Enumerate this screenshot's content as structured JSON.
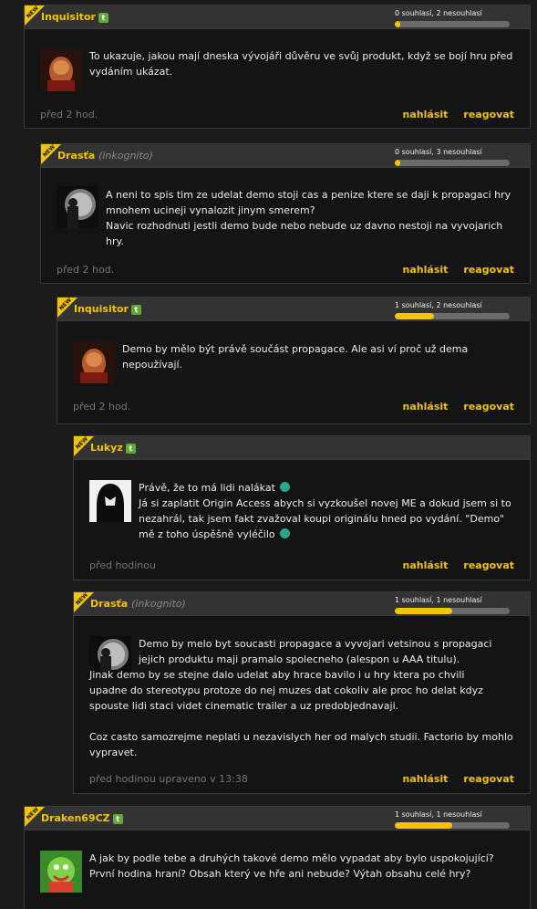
{
  "comments": [
    {
      "author": "Inquisitor",
      "incognito": "",
      "badge": "t",
      "votes_text": "0 souhlasí, 2 nesouhlasí",
      "agree_fraction": 0.05,
      "text": [
        "To ukazuje, jakou mají dneska vývojáři důvěru ve svůj produkt, když se bojí hru před",
        "vydáním ukázat."
      ],
      "time": "před 2 hod.",
      "report": "nahlásit",
      "reply": "reagovat",
      "avatar": "red-demon-avatar"
    },
    {
      "author": "Drasťa",
      "incognito": "(inkognito)",
      "badge": "",
      "votes_text": "0 souhlasí, 3 nesouhlasí",
      "agree_fraction": 0.05,
      "text": [
        "A neni to spis tim ze udelat demo stoji cas a penize ktere se daji k propagaci hry",
        "mnohem ucineji vynalozit jinym smerem?",
        "Navic rozhodnuti jestli demo bude nebo nebude uz davno nestoji na vyvojarich",
        "hry."
      ],
      "time": "před 2 hod.",
      "report": "nahlásit",
      "reply": "reagovat",
      "avatar": "dark-figure-avatar"
    },
    {
      "author": "Inquisitor",
      "incognito": "",
      "badge": "t",
      "votes_text": "1 souhlasí, 2 nesouhlasí",
      "agree_fraction": 0.34,
      "text": [
        "Demo by mělo být právě součást propagace. Ale asi ví proč už dema",
        "nepoužívají."
      ],
      "time": "před 2 hod.",
      "report": "nahlásit",
      "reply": "reagovat",
      "avatar": "red-demon-avatar"
    },
    {
      "author": "Lukyz",
      "incognito": "",
      "badge": "t",
      "votes_text": "",
      "agree_fraction": null,
      "text": [
        "Právě, že to má lidi nalákat",
        "Já si zaplatit Origin Access abych si vyzkoušel novej ME a dokud jsem si to",
        "nezahrál, tak jsem fakt zvažoval koupi originálu hned po vydání. \"Demo\"",
        "mě z toho úspěšně vyléčilo"
      ],
      "time": "před hodinou",
      "report": "nahlásit",
      "reply": "reagovat",
      "avatar": "hooded-figure-avatar"
    },
    {
      "author": "Drasťa",
      "incognito": "(inkognito)",
      "badge": "",
      "votes_text": "1 souhlasí, 1 nesouhlasí",
      "agree_fraction": 0.5,
      "text": [
        "Demo by melo byt soucasti propagace a vyvojari vetsinou s propagaci",
        "jejich produktu maji pramalo spolecneho (alespon u AAA titulu).",
        "Jinak demo by se stejne dalo udelat aby hrace bavilo i u hry ktera po chvili",
        "upadne do stereotypu protoze do nej muzes dat cokoliv ale proc ho delat kdyz",
        "spouste lidi staci videt cinematic trailer a uz predobjednavaji.",
        "",
        "Coz casto samozrejme neplati u nezavislych her od malych studii. Factorio by mohlo",
        "vypravet."
      ],
      "time": "před hodinou upraveno v 13:38",
      "report": "nahlásit",
      "reply": "reagovat",
      "avatar": "dark-figure-avatar"
    },
    {
      "author": "Draken69CZ",
      "incognito": "",
      "badge": "t",
      "votes_text": "1 souhlasí, 1 nesouhlasí",
      "agree_fraction": 0.5,
      "text": [
        "A jak by podle tebe a druhých takové demo mělo vypadat aby bylo uspokojující?",
        "První hodina hraní? Obsah který ve hře ani nebude? Výtah obsahu celé hry?"
      ],
      "time": "",
      "report": "",
      "reply": "",
      "avatar": "green-creature-avatar"
    }
  ],
  "new_label": "NEW",
  "colors": {
    "accent": "#f2c500",
    "badge": "#62a83a",
    "header": "#333333"
  }
}
